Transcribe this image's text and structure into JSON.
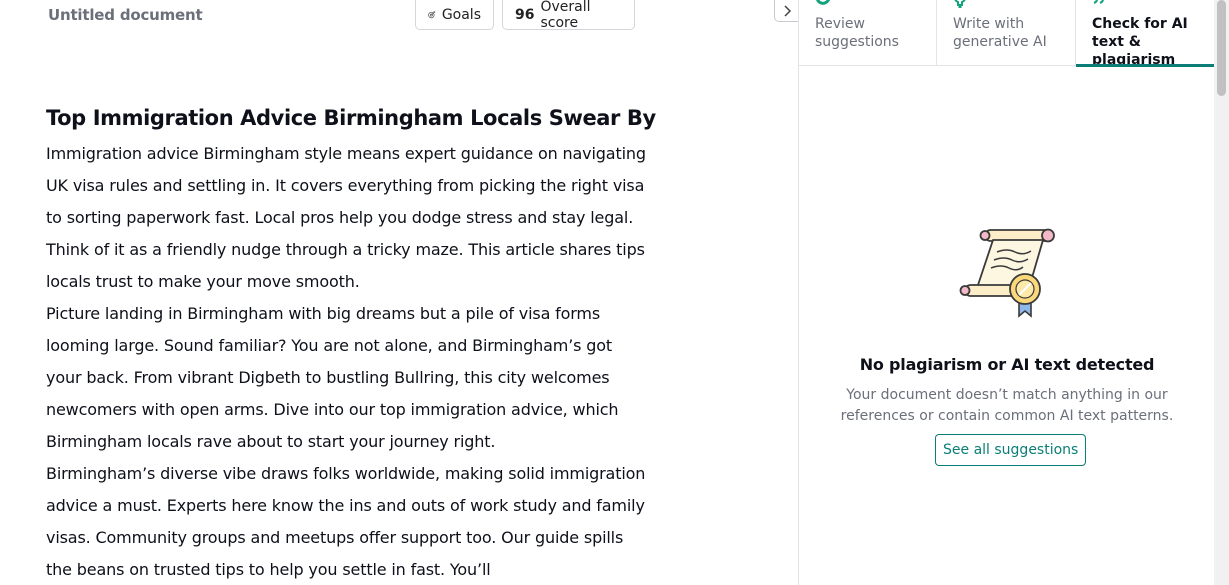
{
  "editor": {
    "doc_title": "Untitled document",
    "goals_label": "Goals",
    "score_value": "96",
    "score_label": "Overall score",
    "article": {
      "heading": "Top Immigration Advice Birmingham Locals Swear By",
      "paragraphs": [
        "Immigration advice Birmingham style means expert guidance on navigating UK visa rules and settling in. It covers everything from picking the right visa to sorting paperwork fast. Local pros help you dodge stress and stay legal. Think of it as a friendly nudge through a tricky maze. This article shares tips locals trust to make your move smooth.",
        "Picture landing in Birmingham with big dreams but a pile of visa forms looming large. Sound familiar? You are not alone, and Birmingham’s got your back. From vibrant Digbeth to bustling Bullring, this city welcomes newcomers with open arms. Dive into our top immigration advice, which Birmingham locals rave about to start your journey right.",
        "Birmingham’s diverse vibe draws folks worldwide, making solid immigration advice a must. Experts here know the ins and outs of work study and family visas. Community groups and meetups offer support too. Our guide spills the beans on trusted tips to help you settle in fast. You’ll"
      ]
    }
  },
  "panel": {
    "tabs": [
      {
        "label": "Review suggestions",
        "icon": "grammarly-logo-icon"
      },
      {
        "label": "Write with generative AI",
        "icon": "lightbulb-icon"
      },
      {
        "label": "Check for AI text & plagiarism",
        "icon": "quote-icon"
      }
    ],
    "empty_state": {
      "title": "No plagiarism or AI text detected",
      "description": "Your document doesn’t match anything in our references or contain common AI text patterns.",
      "button_label": "See all suggestions",
      "illustration": "certificate-scroll-icon"
    }
  },
  "colors": {
    "accent": "#0a7e76",
    "muted_text": "#6b6f7a",
    "body_text": "#0e101a",
    "border": "#e3e4e8"
  }
}
